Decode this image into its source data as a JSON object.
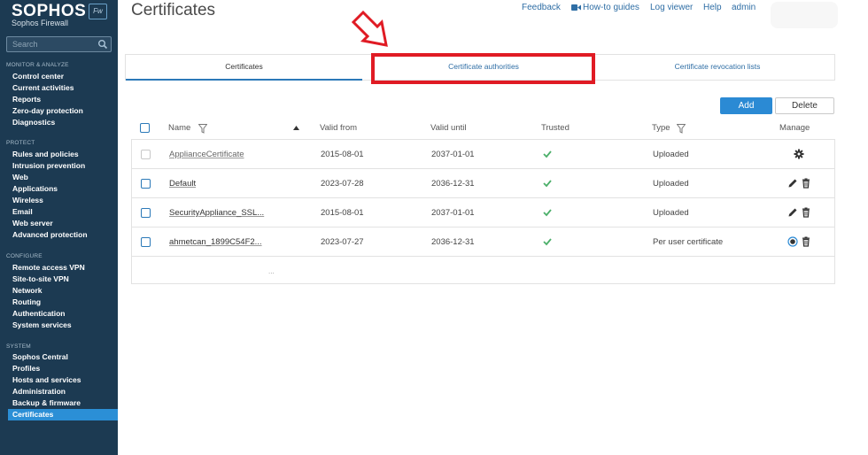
{
  "app": {
    "logo": "SOPHOS",
    "logo_badge": "Fw",
    "subtitle": "Sophos Firewall"
  },
  "search": {
    "placeholder": "Search"
  },
  "sidebar": {
    "sections": [
      {
        "title": "MONITOR & ANALYZE",
        "items": [
          "Control center",
          "Current activities",
          "Reports",
          "Zero-day protection",
          "Diagnostics"
        ]
      },
      {
        "title": "PROTECT",
        "items": [
          "Rules and policies",
          "Intrusion prevention",
          "Web",
          "Applications",
          "Wireless",
          "Email",
          "Web server",
          "Advanced protection"
        ]
      },
      {
        "title": "CONFIGURE",
        "items": [
          "Remote access VPN",
          "Site-to-site VPN",
          "Network",
          "Routing",
          "Authentication",
          "System services"
        ]
      },
      {
        "title": "SYSTEM",
        "items": [
          "Sophos Central",
          "Profiles",
          "Hosts and services",
          "Administration",
          "Backup & firmware",
          "Certificates"
        ]
      }
    ],
    "active": "Certificates"
  },
  "header": {
    "title": "Certificates",
    "links": [
      "Feedback",
      "How-to guides",
      "Log viewer",
      "Help",
      "admin"
    ]
  },
  "tabs": [
    "Certificates",
    "Certificate authorities",
    "Certificate revocation lists"
  ],
  "toolbar": {
    "add": "Add",
    "delete": "Delete"
  },
  "table": {
    "headers": [
      "Name",
      "Valid from",
      "Valid until",
      "Trusted",
      "Type",
      "Manage"
    ],
    "rows": [
      {
        "name": "ApplianceCertificate",
        "valid_from": "2015-08-01",
        "valid_until": "2037-01-01",
        "trusted": true,
        "type": "Uploaded",
        "manage": "gear"
      },
      {
        "name": "Default",
        "valid_from": "2023-07-28",
        "valid_until": "2036-12-31",
        "trusted": true,
        "type": "Uploaded",
        "manage": "edit-delete"
      },
      {
        "name": "SecurityAppliance_SSL...",
        "valid_from": "2015-08-01",
        "valid_until": "2037-01-01",
        "trusted": true,
        "type": "Uploaded",
        "manage": "edit-delete"
      },
      {
        "name": "ahmetcan_1899C54F2...",
        "valid_from": "2023-07-27",
        "valid_until": "2036-12-31",
        "trusted": true,
        "type": "Per user certificate",
        "manage": "radio-delete"
      }
    ],
    "footer": "..."
  },
  "colors": {
    "sidebar": "#1c3a52",
    "accent": "#2b8ad4",
    "highlight": "#e01b24",
    "check": "#4caf6a"
  }
}
